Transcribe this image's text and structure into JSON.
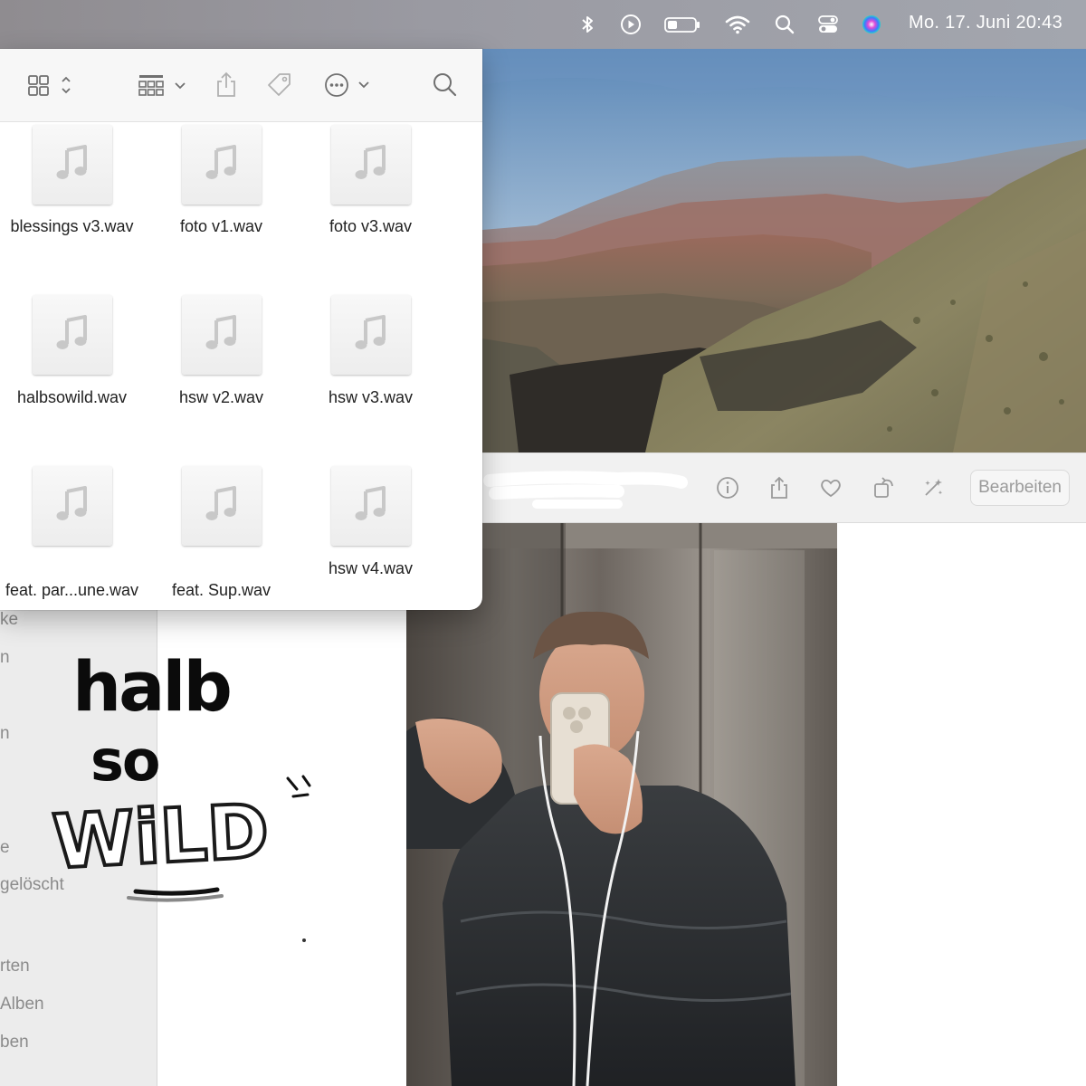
{
  "menubar": {
    "clock": "Mo. 17. Juni  20:43",
    "icons": [
      "bluetooth-icon",
      "play-icon",
      "battery-icon",
      "wifi-icon",
      "search-icon",
      "control-center-icon",
      "siri-icon"
    ]
  },
  "finder": {
    "toolbar_icons": [
      "grid-view-icon",
      "group-icon",
      "share-icon",
      "tag-icon",
      "more-icon",
      "search-icon"
    ],
    "files": [
      {
        "name": "blessings v3.wav"
      },
      {
        "name": "foto v1.wav"
      },
      {
        "name": "foto v3.wav"
      },
      {
        "name": "halbsowild.wav"
      },
      {
        "name": "hsw v2.wav"
      },
      {
        "name": "hsw v3.wav"
      },
      {
        "name": "feat. par...une.wav"
      },
      {
        "name": "feat. Sup.wav"
      },
      {
        "name": "hsw v4.wav"
      }
    ]
  },
  "photos": {
    "toolbar": {
      "edit_label": "Bearbeiten",
      "icons": [
        "info-icon",
        "share-icon",
        "heart-icon",
        "rotate-icon",
        "magic-enhance-icon"
      ]
    },
    "sidebar": {
      "items": [
        {
          "label": "ke"
        },
        {
          "label": "n"
        },
        {
          "label": "n"
        },
        {
          "label": "e"
        },
        {
          "label": "gelöscht"
        },
        {
          "label": "rten"
        },
        {
          "label": "Alben"
        },
        {
          "label": "ben"
        }
      ]
    }
  },
  "artwork": {
    "line1": "halb",
    "line2": "so",
    "line3": "WiLD"
  }
}
